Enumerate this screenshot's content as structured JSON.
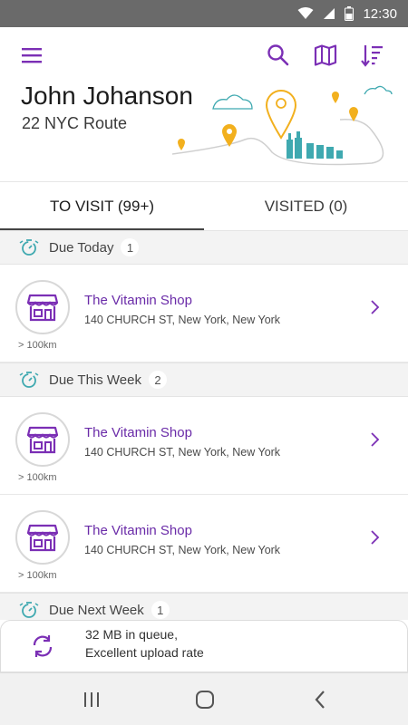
{
  "status_bar": {
    "time": "12:30",
    "icons": [
      "wifi-icon",
      "signal-icon",
      "battery-icon"
    ]
  },
  "header": {
    "user_name": "John Johanson",
    "route_name": "22 NYC Route",
    "icons": [
      "menu-icon",
      "search-icon",
      "map-icon",
      "sort-icon"
    ]
  },
  "colors": {
    "accent": "#7b2fb5",
    "teal": "#3fa9b0",
    "pin": "#f2b01e",
    "store_name": "#6a2ba8"
  },
  "tabs": {
    "to_visit": "TO VISIT (99+)",
    "visited": "VISITED (0)"
  },
  "groups": [
    {
      "title": "Due Today",
      "count": "1",
      "stores": [
        {
          "name": "The Vitamin Shop",
          "address": "140 CHURCH ST, New York, New York",
          "distance": "> 100km"
        }
      ]
    },
    {
      "title": "Due This Week",
      "count": "2",
      "stores": [
        {
          "name": "The Vitamin Shop",
          "address": "140 CHURCH ST, New York, New York",
          "distance": "> 100km"
        },
        {
          "name": "The Vitamin Shop",
          "address": "140 CHURCH ST, New York, New York",
          "distance": "> 100km"
        }
      ]
    },
    {
      "title": "Due Next Week",
      "count": "1",
      "stores": []
    }
  ],
  "upload": {
    "line1": "32 MB in queue,",
    "line2": "Excellent upload rate"
  },
  "nav": [
    "recent-apps-icon",
    "home-icon",
    "back-icon"
  ]
}
